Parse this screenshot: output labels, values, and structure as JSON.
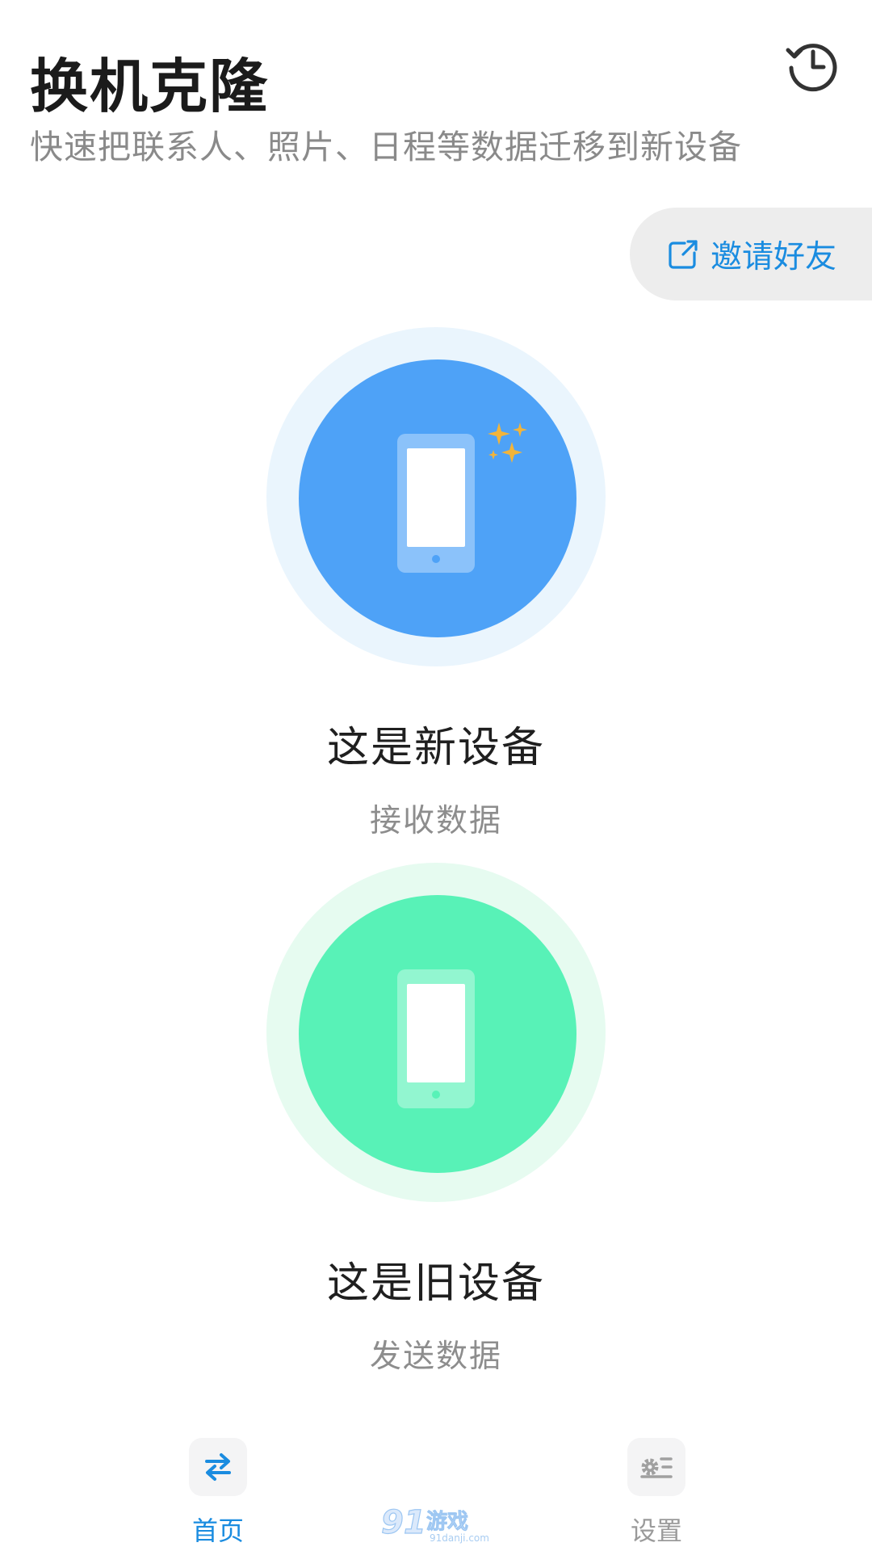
{
  "header": {
    "title": "换机克隆",
    "subtitle": "快速把联系人、照片、日程等数据迁移到新设备",
    "history_icon": "history-icon"
  },
  "invite": {
    "label": "邀请好友",
    "icon": "share-icon"
  },
  "options": {
    "new_device": {
      "title": "这是新设备",
      "subtitle": "接收数据",
      "color": "#4ea2f7",
      "halo_color": "#eaf5fd",
      "sparkle_color": "#f2b43a"
    },
    "old_device": {
      "title": "这是旧设备",
      "subtitle": "发送数据",
      "color": "#58f2b7",
      "halo_color": "#e6fbf0"
    }
  },
  "nav": {
    "home_label": "首页",
    "settings_label": "设置",
    "active": "home",
    "accent": "#1a8ce0"
  },
  "watermark": {
    "text": "91游戏",
    "site": "91danji.com"
  }
}
